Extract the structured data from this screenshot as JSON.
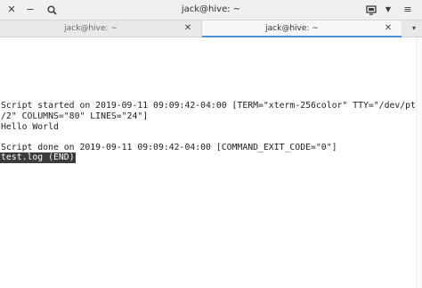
{
  "window": {
    "title": "jack@hive: ~"
  },
  "headerbar": {
    "close_icon": "✕",
    "minimize_icon": "−",
    "search_icon": "⚲",
    "new_tab_icon": "⊞",
    "menu_arrow_icon": "▼",
    "menu_icon": "≡"
  },
  "tabs": [
    {
      "label": "jack@hive: ~",
      "close": "✕",
      "active": false
    },
    {
      "label": "jack@hive: ~",
      "close": "✕",
      "active": true
    }
  ],
  "tab_dropdown": "▾",
  "terminal": {
    "lines": [
      "Script started on 2019-09-11 09:09:42-04:00 [TERM=\"xterm-256color\" TTY=\"/dev/pts",
      "/2\" COLUMNS=\"80\" LINES=\"24\"]",
      "Hello World",
      "Script done on 2019-09-11 09:09:42-04:00 [COMMAND_EXIT_CODE=\"0\"]"
    ],
    "status": "test.log (END)"
  },
  "colors": {
    "accent": "#4a90d9",
    "status_bg": "#3b3b3b"
  }
}
